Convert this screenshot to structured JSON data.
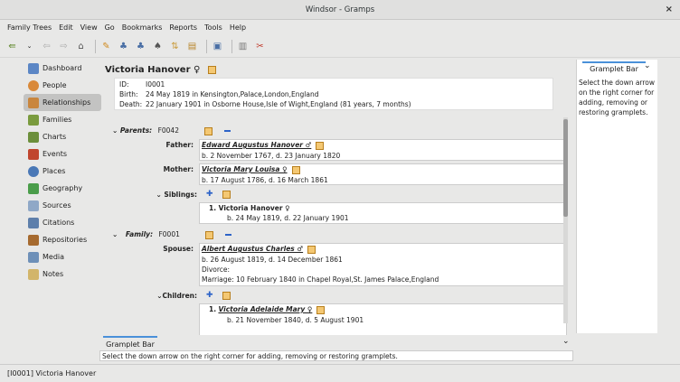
{
  "window": {
    "title": "Windsor - Gramps",
    "close": "×"
  },
  "menu": [
    "Family Trees",
    "Edit",
    "View",
    "Go",
    "Bookmarks",
    "Reports",
    "Tools",
    "Help"
  ],
  "sidebar": {
    "items": [
      {
        "label": "Dashboard",
        "color": "#5b86c5"
      },
      {
        "label": "People",
        "color": "#d9893a"
      },
      {
        "label": "Relationships",
        "color": "#c9863e"
      },
      {
        "label": "Families",
        "color": "#7a9b3e"
      },
      {
        "label": "Charts",
        "color": "#6c8f3b"
      },
      {
        "label": "Events",
        "color": "#c0452e"
      },
      {
        "label": "Places",
        "color": "#4a78b6"
      },
      {
        "label": "Geography",
        "color": "#4a9d4a"
      },
      {
        "label": "Sources",
        "color": "#8fa8c7"
      },
      {
        "label": "Citations",
        "color": "#5e7fab"
      },
      {
        "label": "Repositories",
        "color": "#a66a2f"
      },
      {
        "label": "Media",
        "color": "#6e90b8"
      },
      {
        "label": "Notes",
        "color": "#d2b56a"
      }
    ],
    "active_index": 2
  },
  "person": {
    "name": "Victoria Hanover ♀",
    "id_label": "ID:",
    "id": "I0001",
    "birth_label": "Birth:",
    "birth": "24 May 1819 in Kensington,Palace,London,England",
    "death_label": "Death:",
    "death": "22 January 1901 in Osborne House,Isle of Wight,England (81 years, 7 months)"
  },
  "parents": {
    "label": "Parents:",
    "family_id": "F0042",
    "father_label": "Father:",
    "father": "Edward Augustus Hanover ♂",
    "father_dates": "b. 2 November 1767, d. 23 January 1820",
    "mother_label": "Mother:",
    "mother": "Victoria Mary Louisa ♀",
    "mother_dates": "b. 17 August 1786, d. 16 March 1861",
    "siblings_label": "Siblings:",
    "sibling": "1.  Victoria Hanover ♀",
    "sibling_dates": "b. 24 May 1819, d. 22 January 1901"
  },
  "family": {
    "label": "Family:",
    "family_id": "F0001",
    "spouse_label": "Spouse:",
    "spouse": "Albert Augustus Charles ♂",
    "spouse_dates": "b. 26 August 1819, d. 14 December 1861",
    "divorce": "Divorce:",
    "marriage": "Marriage: 10 February 1840 in Chapel Royal,St. James Palace,England",
    "children_label": "Children:",
    "child": "Victoria Adelaide Mary ♀",
    "child_num": "1.",
    "child_dates": "b. 21 November 1840, d. 5 August 1901"
  },
  "gramplet": {
    "tab": "Gramplet Bar",
    "text": "Select the down arrow on the right corner for adding, removing or restoring gramplets.",
    "bottom_tab": "Gramplet Bar",
    "bottom_text": "Select the down arrow on the right corner for adding, removing or restoring gramplets."
  },
  "status": "[I0001] Victoria Hanover"
}
